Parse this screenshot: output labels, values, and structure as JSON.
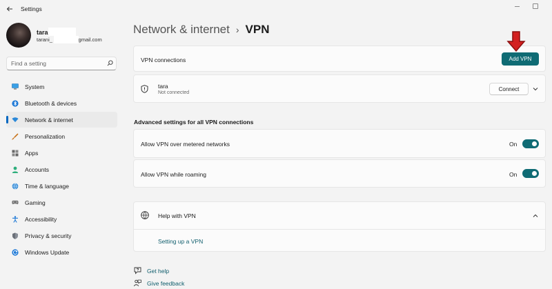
{
  "window": {
    "title": "Settings",
    "back_icon": "back-arrow-icon"
  },
  "profile": {
    "name": "taran",
    "email_prefix": "tarani_",
    "email_domain": "@gmail.com"
  },
  "search": {
    "placeholder": "Find a setting",
    "icon": "search-icon"
  },
  "sidebar": {
    "items": [
      {
        "label": "System",
        "icon": "monitor-icon",
        "active": false
      },
      {
        "label": "Bluetooth & devices",
        "icon": "bluetooth-icon",
        "active": false
      },
      {
        "label": "Network & internet",
        "icon": "wifi-icon",
        "active": true
      },
      {
        "label": "Personalization",
        "icon": "brush-icon",
        "active": false
      },
      {
        "label": "Apps",
        "icon": "apps-icon",
        "active": false
      },
      {
        "label": "Accounts",
        "icon": "person-icon",
        "active": false
      },
      {
        "label": "Time & language",
        "icon": "globe-clock-icon",
        "active": false
      },
      {
        "label": "Gaming",
        "icon": "gamepad-icon",
        "active": false
      },
      {
        "label": "Accessibility",
        "icon": "accessibility-icon",
        "active": false
      },
      {
        "label": "Privacy & security",
        "icon": "shield-icon",
        "active": false
      },
      {
        "label": "Windows Update",
        "icon": "update-icon",
        "active": false
      }
    ]
  },
  "breadcrumb": {
    "parent": "Network & internet",
    "separator": "›",
    "current": "VPN"
  },
  "vpn_connections": {
    "label": "VPN connections",
    "add_button": "Add VPN"
  },
  "vpn_entry": {
    "name": "tara",
    "status": "Not connected",
    "connect_button": "Connect"
  },
  "advanced": {
    "heading": "Advanced settings for all VPN connections",
    "settings": [
      {
        "label": "Allow VPN over metered networks",
        "state": "On"
      },
      {
        "label": "Allow VPN while roaming",
        "state": "On"
      }
    ]
  },
  "help": {
    "title": "Help with VPN",
    "link": "Setting up a VPN"
  },
  "footer": {
    "get_help": "Get help",
    "give_feedback": "Give feedback"
  },
  "colors": {
    "accent": "#0f6b74",
    "nav_indicator": "#0067c0",
    "annotation_arrow": "#d32020"
  }
}
